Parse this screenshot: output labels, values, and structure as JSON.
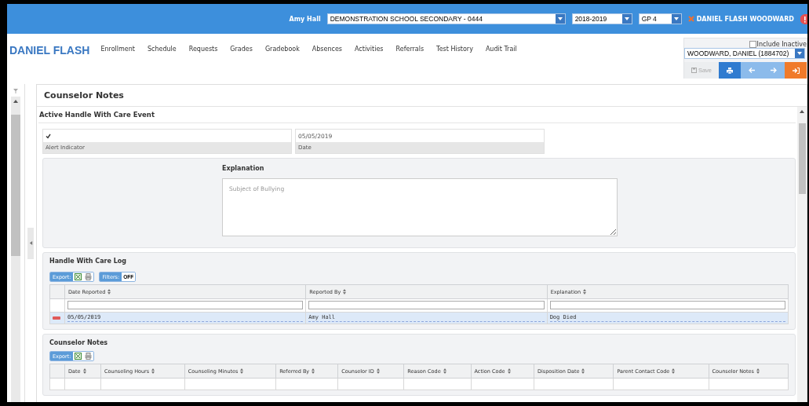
{
  "header": {
    "user": "Amy Hall",
    "school": "DEMONSTRATION SCHOOL SECONDARY - 0444",
    "year": "2018-2019",
    "period": "GP 4",
    "student": "DANIEL FLASH WOODWARD"
  },
  "nav": {
    "title": "DANIEL FLASH",
    "items": [
      "Enrollment",
      "Schedule",
      "Requests",
      "Grades",
      "Gradebook",
      "Absences",
      "Activities",
      "Referrals",
      "Test History",
      "Audit Trail"
    ]
  },
  "student_picker": {
    "include_inactive": {
      "label": "Include Inactive",
      "checked": false
    },
    "student": "WOODWARD, DANIEL (1884702)",
    "save": {
      "label": "Save",
      "disabled": true
    }
  },
  "page_title": "Counselor Notes",
  "event": {
    "title": "Active Handle With Care Event",
    "alert_indicator": {
      "label": "Alert Indicator",
      "checked": true
    },
    "date": {
      "label": "Date",
      "value": "05/05/2019"
    },
    "explanation": {
      "label": "Explanation",
      "placeholder": "Subject of Bullying"
    }
  },
  "log": {
    "title": "Handle With Care Log",
    "export": "Export:",
    "filters": {
      "label": "Filters:",
      "value": "OFF"
    },
    "columns": [
      "Date Reported",
      "Reported By",
      "Explanation"
    ],
    "rows": [
      {
        "cells": [
          "05/05/2019",
          "Amy Hall",
          "Dog Died"
        ],
        "selected": true
      }
    ]
  },
  "notes": {
    "title": "Counselor Notes",
    "export": "Export:",
    "columns": [
      "Date",
      "Counseling Hours",
      "Counseling Minutes",
      "Referred By",
      "Counselor ID",
      "Reason Code",
      "Action Code",
      "Disposition Date",
      "Parent Contact Code",
      "Counselor Notes"
    ]
  }
}
